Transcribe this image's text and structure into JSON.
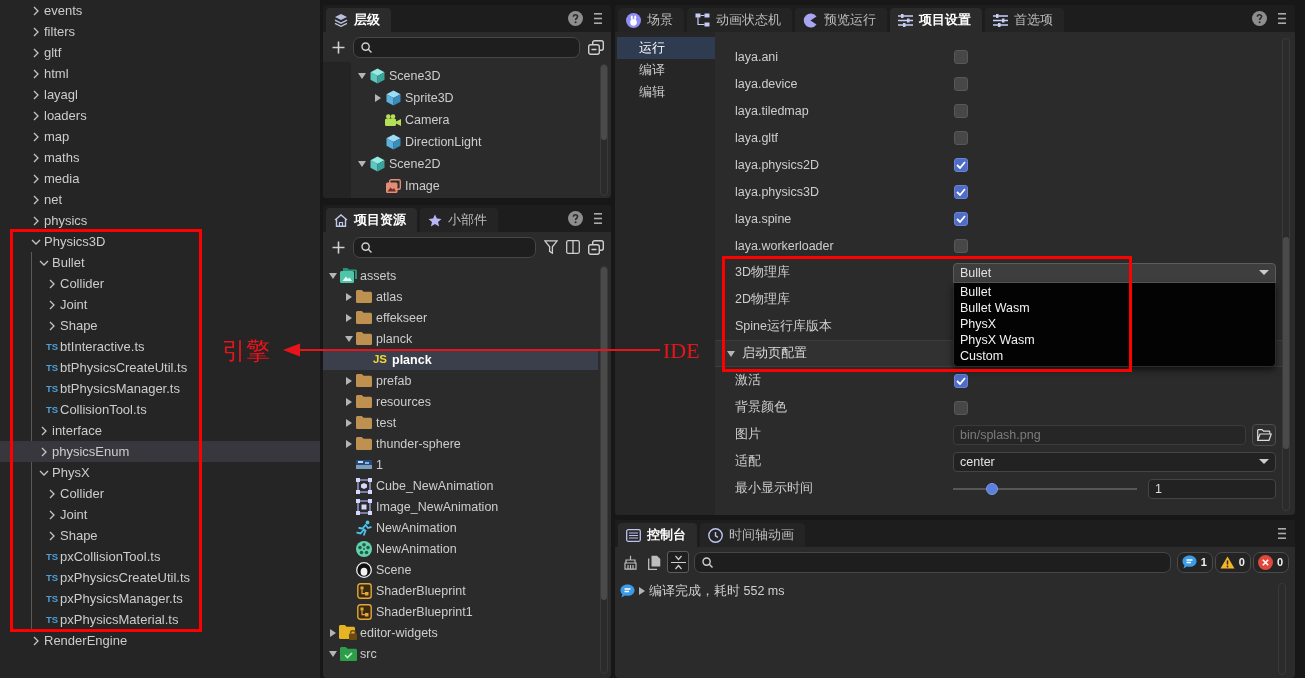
{
  "explorer": {
    "tree": [
      {
        "label": "events",
        "kind": "folder",
        "expanded": false,
        "selected": false
      },
      {
        "label": "filters",
        "kind": "folder",
        "expanded": false,
        "selected": false
      },
      {
        "label": "gltf",
        "kind": "folder",
        "expanded": false,
        "selected": false
      },
      {
        "label": "html",
        "kind": "folder",
        "expanded": false,
        "selected": false
      },
      {
        "label": "layagl",
        "kind": "folder",
        "expanded": false,
        "selected": false
      },
      {
        "label": "loaders",
        "kind": "folder",
        "expanded": false,
        "selected": false
      },
      {
        "label": "map",
        "kind": "folder",
        "expanded": false,
        "selected": false
      },
      {
        "label": "maths",
        "kind": "folder",
        "expanded": false,
        "selected": false
      },
      {
        "label": "media",
        "kind": "folder",
        "expanded": false,
        "selected": false
      },
      {
        "label": "net",
        "kind": "folder",
        "expanded": false,
        "selected": false
      },
      {
        "label": "physics",
        "kind": "folder",
        "expanded": false,
        "selected": false
      },
      {
        "label": "Physics3D",
        "kind": "folder",
        "expanded": true,
        "selected": false,
        "children": [
          {
            "label": "Bullet",
            "kind": "folder",
            "expanded": true,
            "selected": false,
            "children": [
              {
                "label": "Collider",
                "kind": "folder",
                "expanded": false,
                "selected": false
              },
              {
                "label": "Joint",
                "kind": "folder",
                "expanded": false,
                "selected": false
              },
              {
                "label": "Shape",
                "kind": "folder",
                "expanded": false,
                "selected": false
              },
              {
                "label": "btInteractive.ts",
                "kind": "file",
                "file_type": "TS",
                "selected": false
              },
              {
                "label": "btPhysicsCreateUtil.ts",
                "kind": "file",
                "file_type": "TS",
                "selected": false
              },
              {
                "label": "btPhysicsManager.ts",
                "kind": "file",
                "file_type": "TS",
                "selected": false
              },
              {
                "label": "CollisionTool.ts",
                "kind": "file",
                "file_type": "TS",
                "selected": false
              }
            ]
          },
          {
            "label": "interface",
            "kind": "folder",
            "expanded": false,
            "selected": false
          },
          {
            "label": "physicsEnum",
            "kind": "folder",
            "expanded": false,
            "selected": true
          },
          {
            "label": "PhysX",
            "kind": "folder",
            "expanded": true,
            "selected": false,
            "children": [
              {
                "label": "Collider",
                "kind": "folder",
                "expanded": false,
                "selected": false
              },
              {
                "label": "Joint",
                "kind": "folder",
                "expanded": false,
                "selected": false
              },
              {
                "label": "Shape",
                "kind": "folder",
                "expanded": false,
                "selected": false
              },
              {
                "label": "pxCollisionTool.ts",
                "kind": "file",
                "file_type": "TS",
                "selected": false
              },
              {
                "label": "pxPhysicsCreateUtil.ts",
                "kind": "file",
                "file_type": "TS",
                "selected": false
              },
              {
                "label": "pxPhysicsManager.ts",
                "kind": "file",
                "file_type": "TS",
                "selected": false
              },
              {
                "label": "pxPhysicsMaterial.ts",
                "kind": "file",
                "file_type": "TS",
                "selected": false
              }
            ]
          }
        ]
      },
      {
        "label": "RenderEngine",
        "kind": "folder",
        "expanded": false,
        "selected": false
      }
    ]
  },
  "hierarchy": {
    "tabs": [
      {
        "label": "层级",
        "kind": "layers",
        "selected": true
      }
    ],
    "tree": [
      {
        "label": "Scene3D",
        "kind": "scene",
        "expanded": true,
        "selected": false,
        "children": [
          {
            "label": "Sprite3D",
            "kind": "node3d",
            "expanded": false,
            "selected": false
          },
          {
            "label": "Camera",
            "kind": "camera",
            "selected": false
          },
          {
            "label": "DirectionLight",
            "kind": "node3d",
            "selected": false
          }
        ]
      },
      {
        "label": "Scene2D",
        "kind": "scene",
        "expanded": true,
        "selected": false,
        "children": [
          {
            "label": "Image",
            "kind": "image",
            "selected": false
          }
        ]
      }
    ]
  },
  "assets": {
    "tabs": [
      {
        "label": "项目资源",
        "kind": "home",
        "selected": true
      },
      {
        "label": "小部件",
        "kind": "star",
        "selected": false
      }
    ],
    "tree": [
      {
        "label": "assets",
        "kind": "asset-root",
        "expanded": true,
        "selected": false,
        "children": [
          {
            "label": "atlas",
            "kind": "folder",
            "expanded": false,
            "selected": false
          },
          {
            "label": "effekseer",
            "kind": "folder",
            "expanded": false,
            "selected": false
          },
          {
            "label": "planck",
            "kind": "folder",
            "expanded": true,
            "selected": false,
            "children": [
              {
                "label": "planck",
                "kind": "script",
                "file_type": "JS",
                "selected": true
              }
            ]
          },
          {
            "label": "prefab",
            "kind": "folder",
            "expanded": false,
            "selected": false
          },
          {
            "label": "resources",
            "kind": "folder",
            "expanded": false,
            "selected": false
          },
          {
            "label": "test",
            "kind": "folder",
            "expanded": false,
            "selected": false
          },
          {
            "label": "thunder-sphere",
            "kind": "folder",
            "expanded": false,
            "selected": false
          },
          {
            "label": "1",
            "kind": "texture",
            "selected": false
          },
          {
            "label": "Cube_NewAnimation",
            "kind": "anim-3d",
            "selected": false
          },
          {
            "label": "Image_NewAnimation",
            "kind": "anim-2d",
            "selected": false
          },
          {
            "label": "NewAnimation",
            "kind": "clip",
            "selected": false
          },
          {
            "label": "NewAnimation",
            "kind": "animator",
            "selected": false
          },
          {
            "label": "Scene",
            "kind": "scene",
            "selected": false
          },
          {
            "label": "ShaderBlueprint",
            "kind": "blueprint",
            "selected": false
          },
          {
            "label": "ShaderBlueprint1",
            "kind": "blueprint",
            "selected": false
          }
        ]
      },
      {
        "label": "editor-widgets",
        "kind": "locked-folder",
        "expanded": false,
        "selected": false
      },
      {
        "label": "src",
        "kind": "code-folder",
        "expanded": true,
        "selected": false
      }
    ]
  },
  "settings": {
    "tabs": [
      {
        "label": "场景",
        "kind": "scene",
        "selected": false
      },
      {
        "label": "动画状态机",
        "kind": "state-machine",
        "selected": false
      },
      {
        "label": "预览运行",
        "kind": "preview",
        "selected": false
      },
      {
        "label": "项目设置",
        "kind": "sliders",
        "selected": true
      },
      {
        "label": "首选项",
        "kind": "sliders",
        "selected": false
      }
    ],
    "sidebar": [
      {
        "label": "运行",
        "selected": true
      },
      {
        "label": "编译",
        "selected": false
      },
      {
        "label": "编辑",
        "selected": false
      }
    ],
    "rows": [
      {
        "kind": "checkbox",
        "label": "laya.ani",
        "checked": false
      },
      {
        "kind": "checkbox",
        "label": "laya.device",
        "checked": false
      },
      {
        "kind": "checkbox",
        "label": "laya.tiledmap",
        "checked": false
      },
      {
        "kind": "checkbox",
        "label": "laya.gltf",
        "checked": false
      },
      {
        "kind": "checkbox",
        "label": "laya.physics2D",
        "checked": true
      },
      {
        "kind": "checkbox",
        "label": "laya.physics3D",
        "checked": true
      },
      {
        "kind": "checkbox",
        "label": "laya.spine",
        "checked": true
      },
      {
        "kind": "checkbox",
        "label": "laya.workerloader",
        "checked": false
      },
      {
        "kind": "select",
        "label": "3D物理库",
        "value": "Bullet",
        "expanded": true,
        "options": [
          "Bullet",
          "Bullet Wasm",
          "PhysX",
          "PhysX Wasm",
          "Custom"
        ]
      },
      {
        "kind": "label",
        "label": "2D物理库"
      },
      {
        "kind": "label",
        "label": "Spine运行库版本"
      },
      {
        "kind": "section",
        "label": "启动页配置",
        "expanded": true
      },
      {
        "kind": "checkbox",
        "label": "激活",
        "checked": true
      },
      {
        "kind": "checkbox",
        "label": "背景颜色",
        "checked": false
      },
      {
        "kind": "file",
        "label": "图片",
        "placeholder": "bin/splash.png"
      },
      {
        "kind": "select",
        "label": "适配",
        "value": "center",
        "expanded": false
      },
      {
        "kind": "slider",
        "label": "最小显示时间",
        "level": 0.21,
        "value": "1"
      }
    ]
  },
  "console": {
    "tabs": [
      {
        "label": "控制台",
        "kind": "console",
        "selected": true
      },
      {
        "label": "时间轴动画",
        "kind": "timeline",
        "selected": false
      }
    ],
    "tools": [
      {
        "kind": "clear",
        "on": false
      },
      {
        "kind": "copy",
        "on": false
      },
      {
        "kind": "collapse",
        "on": true
      }
    ],
    "counters": [
      {
        "kind": "info",
        "count": "1"
      },
      {
        "kind": "warning",
        "count": "0"
      },
      {
        "kind": "error",
        "count": "0"
      }
    ],
    "logs": [
      {
        "kind": "info",
        "expanded": false,
        "text": "编译完成，耗时 552 ms"
      }
    ]
  },
  "annotations": {
    "labels": [
      "引擎",
      "IDE"
    ]
  }
}
